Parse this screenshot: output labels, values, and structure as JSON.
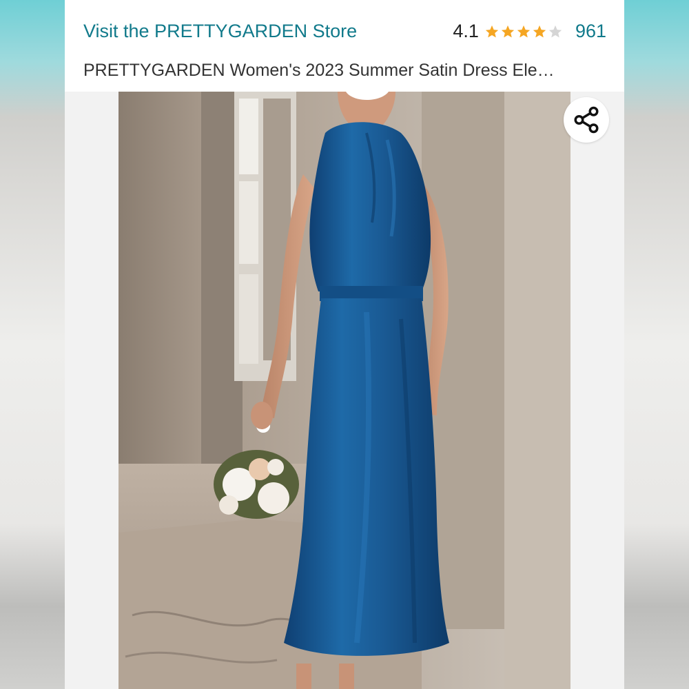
{
  "header": {
    "store_link": "Visit the PRETTYGARDEN Store",
    "rating_value": "4.1",
    "rating_stars": 4.1,
    "review_count": "961",
    "product_title": "PRETTYGARDEN Women's 2023 Summer Satin Dress Ele…"
  },
  "image": {
    "alt": "Woman in a blue satin halter maxi dress holding a bouquet"
  },
  "icons": {
    "share": "share-icon",
    "star": "star-icon"
  },
  "colors": {
    "link": "#117a8b",
    "star_fill": "#f5a623",
    "star_empty": "#d5d5d5",
    "dress": "#1a5a94"
  }
}
